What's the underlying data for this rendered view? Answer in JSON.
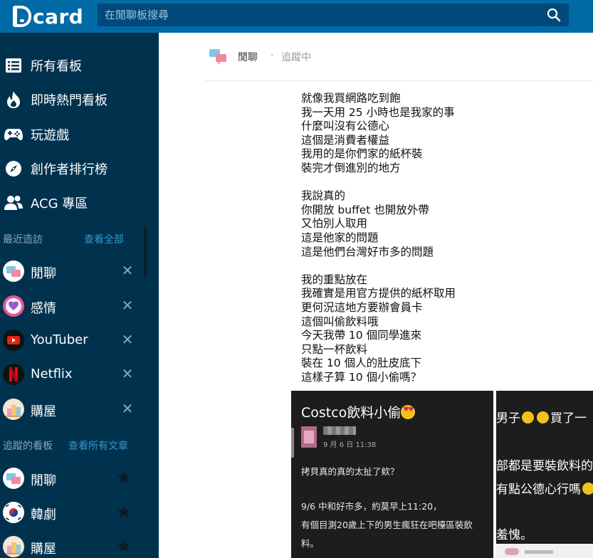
{
  "header": {
    "logo_text": "card",
    "search_placeholder": "在閒聊板搜尋"
  },
  "sidebar": {
    "nav": [
      {
        "label": "所有看板",
        "icon": "list-icon"
      },
      {
        "label": "即時熱門看板",
        "icon": "fire-icon"
      },
      {
        "label": "玩遊戲",
        "icon": "gamepad-icon"
      },
      {
        "label": "創作者排行榜",
        "icon": "compass-icon"
      },
      {
        "label": "ACG 專區",
        "icon": "people-icon"
      }
    ],
    "recent_title": "最近造訪",
    "recent_link": "查看全部",
    "recent": [
      {
        "label": "閒聊"
      },
      {
        "label": "感情"
      },
      {
        "label": "YouTuber"
      },
      {
        "label": "Netflix"
      },
      {
        "label": "購屋"
      }
    ],
    "following_title": "追蹤的看板",
    "following_link": "查看所有文章",
    "following": [
      {
        "label": "閒聊"
      },
      {
        "label": "韓劇"
      },
      {
        "label": "購屋"
      }
    ]
  },
  "board_header": {
    "name": "閒聊",
    "separator": "·",
    "follow_status": "追蹤中"
  },
  "post": {
    "lines": [
      "就像我買網路吃到飽",
      "我一天用 25 小時也是我家的事",
      "什麼叫沒有公德心",
      "這個是消費者權益",
      "我用的是你們家的紙杯裝",
      "裝完才倒進別的地方",
      "",
      "我說真的",
      "你開放 buffet 也開放外帶",
      "又怕別人取用",
      "這是他家的問題",
      "這是他們台灣好市多的問題",
      "",
      "我的重點放在",
      "我確實是用官方提供的紙杯取用",
      "更何況這地方要辦會員卡",
      "這個叫偷飲料哦",
      "今天我帶 10 個同學進來",
      "只點一杯飲料",
      "裝在 10 個人的肚皮底下",
      "這樣子算 10 個小偷嗎？"
    ]
  },
  "screenshot_left": {
    "title": "Costco飲料小偷",
    "date": "9 月 6 日 11:38",
    "lines": [
      "拷貝真的真的太扯了欸？",
      "",
      "9/6 中和好市多，約莫早上11:20，",
      "有個目測20歲上下的男生瘋狂在吧檯區裝飲",
      "料。"
    ]
  },
  "screenshot_right": {
    "lines": [
      "男子",
      "買了一",
      "部都是要裝飲料的",
      "有點公德心行嗎",
      "羞愧。"
    ]
  },
  "colors": {
    "topbar": "#006aa6",
    "sidebar": "#00324e",
    "accent_link": "#3397cf"
  }
}
